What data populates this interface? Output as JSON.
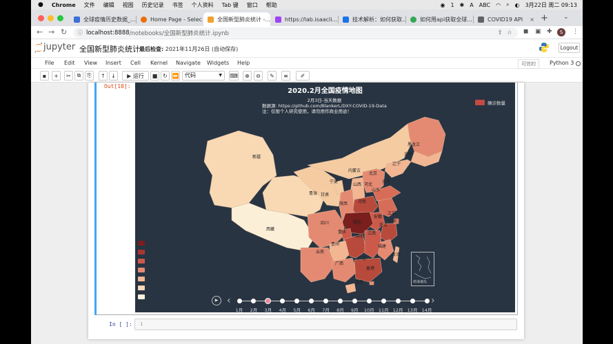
{
  "macos": {
    "menu": [
      "Chrome",
      "文件",
      "编辑",
      "视图",
      "历史记录",
      "书签",
      "个人资料",
      "Tab 键",
      "窗口",
      "帮助"
    ],
    "status": {
      "input_method": "ABC",
      "notifications": "1",
      "datetime": "3月22日 周二  09:13"
    }
  },
  "browser": {
    "tabs": [
      {
        "label": "全球疫情历史数据_...",
        "color": "#3c6fd7"
      },
      {
        "label": "Home Page - Selec...",
        "color": "#e8710a"
      },
      {
        "label": "全国新型肺炎统计 -...",
        "color": "#f0a030"
      },
      {
        "label": "https://lab.isaacli...",
        "color": "#a142f4"
      },
      {
        "label": "技术解析：如何获取...",
        "color": "#1a73e8"
      },
      {
        "label": "如何用api获取全球...",
        "color": "#34a853"
      },
      {
        "label": "COVID19 API",
        "color": "#5f6368"
      }
    ],
    "url_host": "localhost:8888",
    "url_path": "/notebooks/全国新型肺炎统计.ipynb"
  },
  "jupyter": {
    "logo": "jupyter",
    "notebook_title": "全国新型肺炎统计",
    "checkpoint_label": "最后检查:",
    "checkpoint_date": "2021年11月26日",
    "checkpoint_status": "(自动保存)",
    "logout": "Logout",
    "menu": [
      "File",
      "Edit",
      "View",
      "Insert",
      "Cell",
      "Kernel",
      "Navigate",
      "Widgets",
      "Help"
    ],
    "trusted": "可信的",
    "kernel": "Python 3",
    "toolbar": {
      "run_label": "运行",
      "cell_type": "代码"
    },
    "out_prompt": "Out[10]:",
    "in_prompt": "In [ ]:",
    "in_line_number": "1"
  },
  "chart_data": {
    "type": "map",
    "title": "2020.2月全国疫情地图",
    "subtitle_lines": [
      "2月3日-当天数据",
      "数据源: https://github.com/BlankerL/DXY-COVID-19-Data",
      "注：仅限个人研究使用，请勿用作商业用途！"
    ],
    "legend": "确诊数量",
    "timeline": {
      "labels": [
        "1月",
        "2月",
        "3月",
        "4月",
        "5月",
        "6月",
        "7月",
        "8月",
        "9月",
        "10月",
        "11月",
        "12月",
        "13月",
        "14月"
      ],
      "current_index": 2
    },
    "visualmap_colors": [
      "#7a1e1e",
      "#a8362f",
      "#cc5a4b",
      "#e58a72",
      "#f2b693",
      "#f8d7b6",
      "#fdf0dc"
    ],
    "regions": [
      {
        "name": "新疆",
        "color": "#f8d9b4"
      },
      {
        "name": "西藏",
        "color": "#fcefd8"
      },
      {
        "name": "青海",
        "color": "#f8d9b4"
      },
      {
        "name": "甘肃",
        "color": "#f5cba2"
      },
      {
        "name": "内蒙古",
        "color": "#f5cba2"
      },
      {
        "name": "黑龙江",
        "color": "#e58a72"
      },
      {
        "name": "吉林",
        "color": "#f2b693"
      },
      {
        "name": "辽宁",
        "color": "#f2b693"
      },
      {
        "name": "北京",
        "color": "#d76d58"
      },
      {
        "name": "天津",
        "color": "#e58a72"
      },
      {
        "name": "河北",
        "color": "#e58a72"
      },
      {
        "name": "山西",
        "color": "#f2b693"
      },
      {
        "name": "山东",
        "color": "#d76d58"
      },
      {
        "name": "宁夏",
        "color": "#f5cba2"
      },
      {
        "name": "陕西",
        "color": "#e58a72"
      },
      {
        "name": "河南",
        "color": "#b84a3c"
      },
      {
        "name": "江苏",
        "color": "#d76d58"
      },
      {
        "name": "安徽",
        "color": "#cc5a4b"
      },
      {
        "name": "上海",
        "color": "#d76d58"
      },
      {
        "name": "湖北",
        "color": "#7a1e1e"
      },
      {
        "name": "四川",
        "color": "#e58a72"
      },
      {
        "name": "重庆",
        "color": "#cc5a4b"
      },
      {
        "name": "浙江",
        "color": "#b84a3c"
      },
      {
        "name": "湖南",
        "color": "#b84a3c"
      },
      {
        "name": "江西",
        "color": "#cc5a4b"
      },
      {
        "name": "贵州",
        "color": "#f2b693"
      },
      {
        "name": "福建",
        "color": "#e58a72"
      },
      {
        "name": "云南",
        "color": "#e58a72"
      },
      {
        "name": "广西",
        "color": "#e58a72"
      },
      {
        "name": "广东",
        "color": "#b84a3c"
      },
      {
        "name": "台湾",
        "color": "#f2b693"
      },
      {
        "name": "香港",
        "color": "#e58a72"
      },
      {
        "name": "海南",
        "color": "#f2b693"
      }
    ],
    "inset_label": "南海诸岛"
  }
}
